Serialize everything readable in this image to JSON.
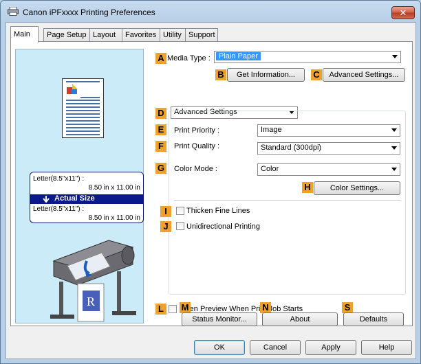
{
  "window": {
    "title": "Canon iPFxxxx Printing Preferences",
    "close_glyph": "✕"
  },
  "tabs": [
    {
      "label": "Main",
      "active": true
    },
    {
      "label": "Page Setup"
    },
    {
      "label": "Layout"
    },
    {
      "label": "Favorites"
    },
    {
      "label": "Utility"
    },
    {
      "label": "Support"
    }
  ],
  "preview": {
    "original_size": "Letter(8.5\"x11\") :",
    "original_dims": "8.50 in x 11.00 in",
    "scaling": "Actual Size",
    "output_size": "Letter(8.5\"x11\") :",
    "output_dims": "8.50 in x 11.00 in",
    "output_paper_letter": "R"
  },
  "badges": {
    "A": "A",
    "B": "B",
    "C": "C",
    "D": "D",
    "E": "E",
    "F": "F",
    "G": "G",
    "H": "H",
    "I": "I",
    "J": "J",
    "L": "L",
    "M": "M",
    "N": "N",
    "S": "S"
  },
  "media_type": {
    "label": "Media Type :",
    "value": "Plain Paper"
  },
  "buttons": {
    "get_information": "Get Information...",
    "advanced_settings": "Advanced Settings...",
    "color_settings": "Color Settings...",
    "status_monitor": "Status Monitor...",
    "about": "About",
    "defaults": "Defaults",
    "ok": "OK",
    "cancel": "Cancel",
    "apply": "Apply",
    "help": "Help"
  },
  "settings_mode": {
    "value": "Advanced Settings"
  },
  "print_priority": {
    "label": "Print Priority :",
    "value": "Image"
  },
  "print_quality": {
    "label": "Print Quality :",
    "value": "Standard (300dpi)"
  },
  "color_mode": {
    "label": "Color Mode :",
    "value": "Color"
  },
  "checkboxes": {
    "thicken": "Thicken Fine Lines",
    "unidirectional": "Unidirectional Printing",
    "open_preview": "Open Preview When Print Job Starts"
  },
  "colors": {
    "badge": "#f0a02c",
    "scaling_bar": "#0b1a8a",
    "selected": "#3399ff"
  }
}
